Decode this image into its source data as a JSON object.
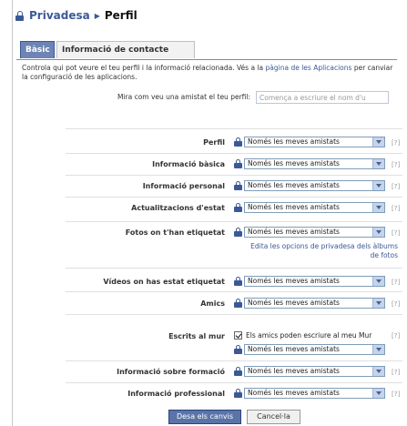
{
  "breadcrumb": {
    "parent": "Privadesa",
    "current": "Perfil"
  },
  "tabs": [
    {
      "label": "Bàsic",
      "active": true
    },
    {
      "label": "Informació de contacte",
      "active": false
    }
  ],
  "intro": {
    "text_before": "Controla qui pot veure el teu perfil i la informació relacionada. Vés a la ",
    "link": "pàgina de les Aplicacions",
    "text_after": " per canviar la configuració de les aplicacions."
  },
  "preview": {
    "label": "Mira com veu una amistat el teu perfil:",
    "placeholder": "Comença a escriure el nom d'u"
  },
  "settings": [
    {
      "label": "Perfil",
      "value": "Només les meves amistats",
      "help": "[?]"
    },
    {
      "label": "Informació bàsica",
      "value": "Només les meves amistats",
      "help": "[?]"
    },
    {
      "label": "Informació personal",
      "value": "Només les meves amistats",
      "help": "[?]"
    },
    {
      "label": "Actualitzacions d'estat",
      "value": "Només les meves amistats",
      "help": "[?]"
    },
    {
      "label": "Fotos on t'han etiquetat",
      "value": "Només les meves amistats",
      "help": "[?]",
      "sub_link": "Edita les opcions de privadesa dels àlbums de fotos"
    },
    {
      "label": "Vídeos on has estat etiquetat",
      "value": "Només les meves amistats",
      "help": "[?]"
    },
    {
      "label": "Amics",
      "value": "Només les meves amistats",
      "help": "[?]"
    },
    {
      "label": "Escrits al mur",
      "checkbox_label": "Els amics poden escriure al meu Mur",
      "checked": true,
      "value": "Només les meves amistats",
      "help": "[?]"
    },
    {
      "label": "Informació sobre formació",
      "value": "Només les meves amistats",
      "help": "[?]"
    },
    {
      "label": "Informació professional",
      "value": "Només les meves amistats",
      "help": "[?]"
    }
  ],
  "buttons": {
    "save": "Desa els canvis",
    "cancel": "Cancel·la"
  },
  "colors": {
    "accent": "#3b5998",
    "tab_active": "#6d84b4",
    "button_save": "#5b74a8"
  }
}
